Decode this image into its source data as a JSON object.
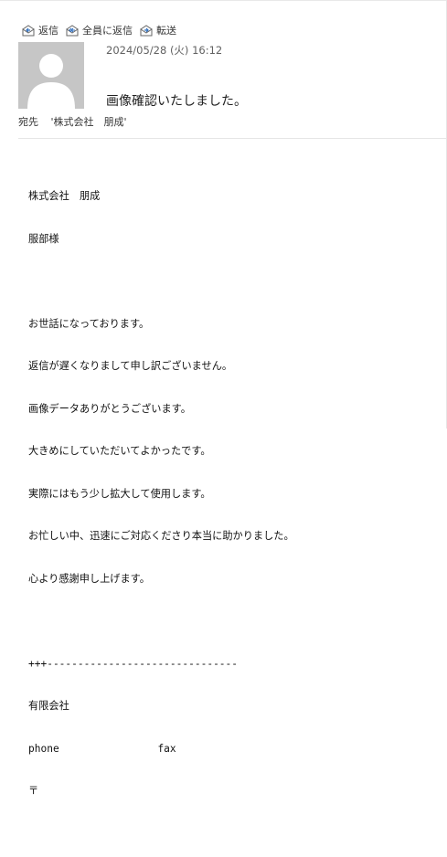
{
  "toolbar": {
    "reply_label": "返信",
    "reply_all_label": "全員に返信",
    "forward_label": "転送"
  },
  "header": {
    "date": "2024/05/28 (火) 16:12",
    "subject": "画像確認いたしました。",
    "to_label": "宛先",
    "to_value": "'株式会社　朋成'"
  },
  "body_lines": [
    "株式会社　朋成",
    "服部様",
    "",
    "お世話になっております。",
    "返信が遅くなりまして申し訳ございません。",
    "画像データありがとうございます。",
    "大きめにしていただいてよかったです。",
    "実際にはもう少し拡大して使用します。",
    "お忙しい中、迅速にご対応くださり本当に助かりました。",
    "心より感謝申し上げます。",
    "",
    "+++-------------------------------",
    "有限会社",
    "phone                fax",
    "〒",
    "",
    "-------------------------------+++"
  ],
  "colors": {
    "avatar_bg": "#c6c6c6",
    "avatar_fg": "#ffffff",
    "icon_blue": "#2f6fbf"
  },
  "icons": [
    "reply-icon",
    "reply-all-icon",
    "forward-icon",
    "avatar-person-icon"
  ]
}
